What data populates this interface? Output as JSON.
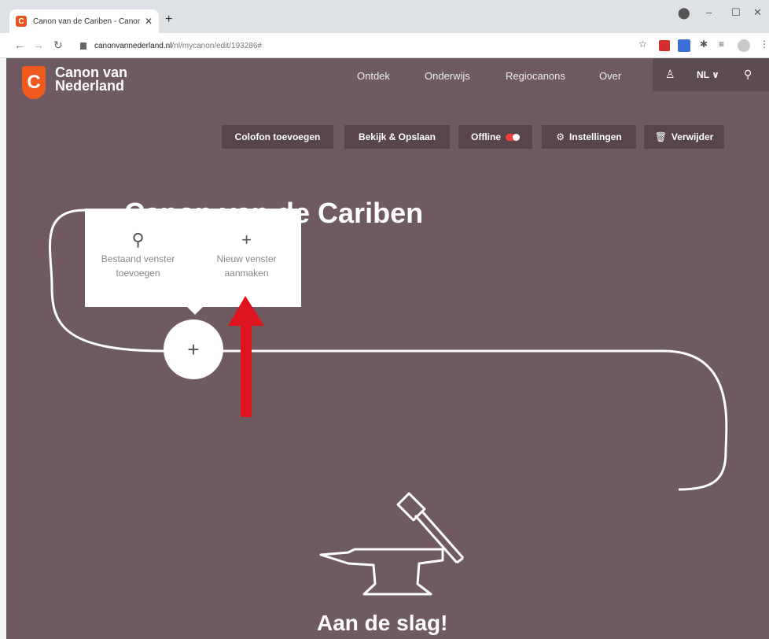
{
  "browser": {
    "tab_title": "Canon van de Cariben - Canon v",
    "tab_close": "✕",
    "new_tab": "+",
    "url_host": "canonvannederland.nl",
    "url_path": "/nl/mycanon/edit/193286#",
    "window_controls": [
      "–",
      "☐",
      "✕"
    ]
  },
  "site": {
    "logo_letter": "C",
    "logo_line1": "Canon van",
    "logo_line2": "Nederland",
    "nav": [
      "Ontdek",
      "Onderwijs",
      "Regiocanons",
      "Over"
    ],
    "language": "NL ∨",
    "toolbar": {
      "colofon": "Colofon toevoegen",
      "bekijk": "Bekijk & Opslaan",
      "offline": "Offline",
      "instellingen": "Instellingen",
      "verwijder": "Verwijder"
    },
    "canon_title": "Canon van de Cariben",
    "popup": {
      "existing_line1": "Bestaand venster",
      "existing_line2": "toevoegen",
      "new_line1": "Nieuw venster",
      "new_line2": "aanmaken"
    },
    "plus": "+",
    "start_label": "Aan de slag!"
  },
  "colors": {
    "site_bg": "#6e5a60",
    "button_bg": "#574549",
    "brand_orange": "#ef5a1f",
    "arrow_red": "#e0141e"
  }
}
